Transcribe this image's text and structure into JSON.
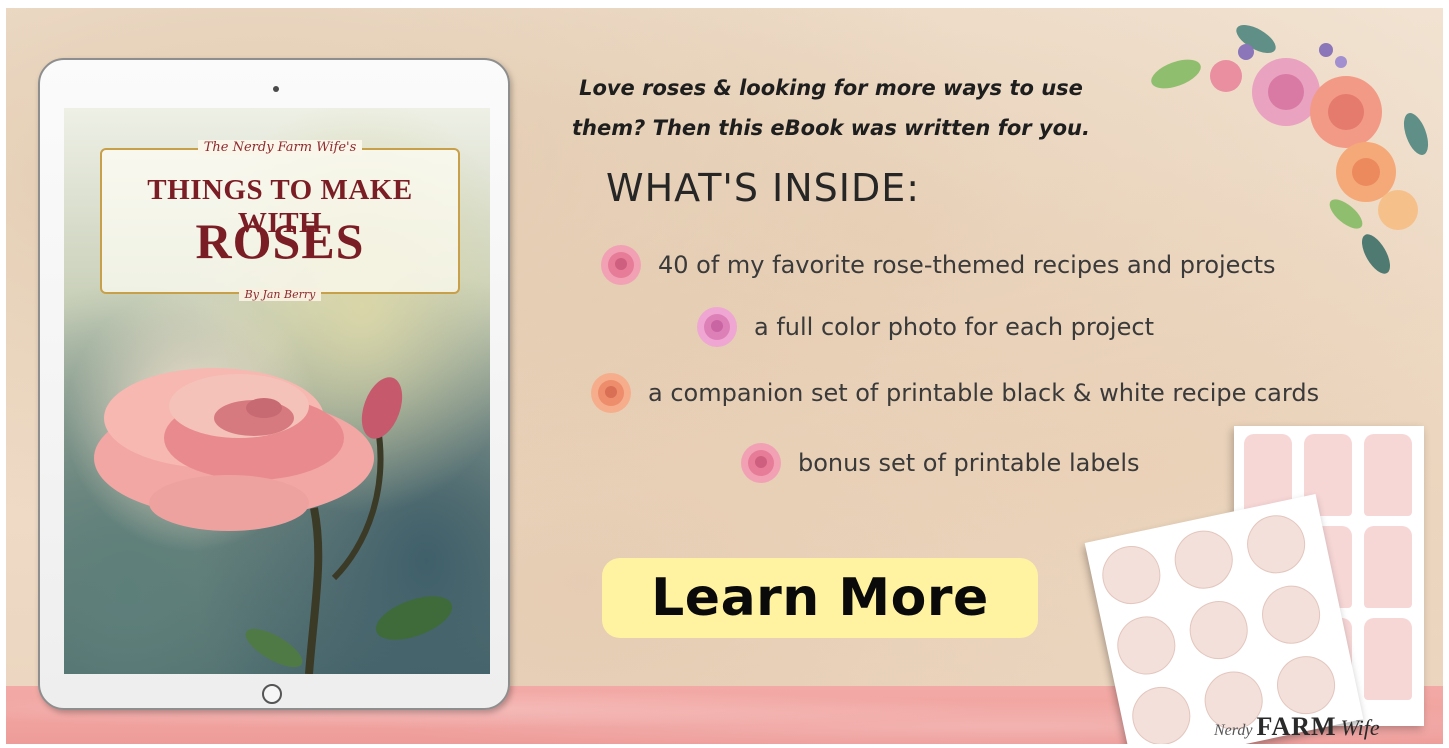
{
  "cover": {
    "series": "The Nerdy Farm Wife's",
    "title_line1": "THINGS TO MAKE WITH",
    "title_line2": "ROSES",
    "author": "By Jan Berry"
  },
  "intro": {
    "line1": "Love roses & looking for more ways to use",
    "line2": "them? Then this eBook was written for you."
  },
  "whats_inside": {
    "heading": "WHAT'S INSIDE:",
    "items": [
      {
        "text": "40 of my favorite rose-themed recipes and projects",
        "icon": "pink-rose-icon"
      },
      {
        "text": "a full color photo for each project",
        "icon": "pink-rose-icon"
      },
      {
        "text": "a companion set of printable black & white recipe cards",
        "icon": "peach-rose-icon"
      },
      {
        "text": "bonus set of printable labels",
        "icon": "pink-rose-icon"
      }
    ]
  },
  "cta": {
    "label": "Learn More",
    "color": "#fff3a2"
  },
  "brand": {
    "small": "Nerdy",
    "big": "FARM",
    "script": "Wife"
  },
  "colors": {
    "accent_dark_red": "#7a1d24",
    "strip_pink": "#ee9c99",
    "button_yellow": "#fff3a2"
  }
}
